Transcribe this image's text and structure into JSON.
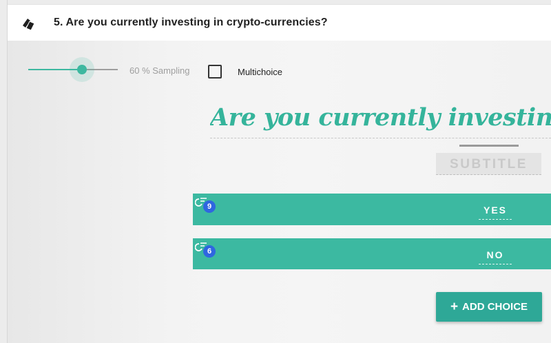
{
  "header": {
    "title": "5. Are you currently investing in crypto-currencies?",
    "icon": "cards-icon"
  },
  "settings": {
    "sampling": {
      "value_percent": 60,
      "label": "60 % Sampling"
    },
    "multichoice": {
      "label": "Multichoice",
      "checked": false
    }
  },
  "question": {
    "title": "Are you currently investing in crypto-currencies?",
    "subtitle_placeholder": "SUBTITLE"
  },
  "choices": [
    {
      "label": "YES",
      "count": "9",
      "icon": "refresh-list-icon"
    },
    {
      "label": "NO",
      "count": "6",
      "icon": "refresh-list-icon"
    }
  ],
  "add_choice": {
    "plus": "+",
    "label": "ADD CHOICE"
  },
  "colors": {
    "accent": "#3cb9a1",
    "title_text": "#35b49b",
    "badge": "#2f66e0",
    "button": "#2ea897"
  }
}
